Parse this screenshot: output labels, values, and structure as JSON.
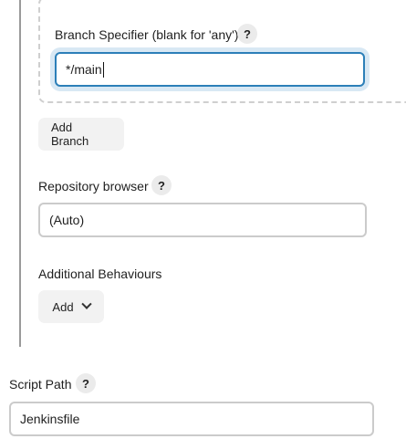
{
  "branch": {
    "label": "Branch Specifier (blank for 'any')",
    "help": "?",
    "value": "*/main",
    "add_branch_label": "Add Branch"
  },
  "repo_browser": {
    "label": "Repository browser",
    "help": "?",
    "value": "(Auto)"
  },
  "behaviours": {
    "label": "Additional Behaviours",
    "add_label": "Add"
  },
  "script_path": {
    "label": "Script Path",
    "help": "?",
    "value": "Jenkinsfile"
  }
}
